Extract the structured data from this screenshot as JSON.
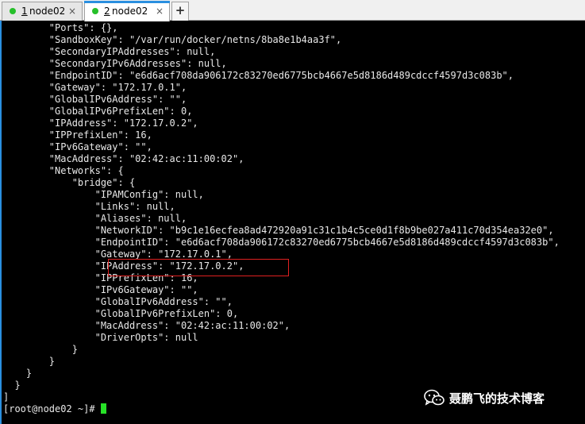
{
  "tabs": [
    {
      "number": "1",
      "name": "node02",
      "status_color": "#26c02a",
      "active": false
    },
    {
      "number": "2",
      "name": "node02",
      "status_color": "#26c02a",
      "active": true
    }
  ],
  "tab_close_glyph": "×",
  "add_tab_glyph": "+",
  "terminal": {
    "lines": [
      "        \"Ports\": {},",
      "        \"SandboxKey\": \"/var/run/docker/netns/8ba8e1b4aa3f\",",
      "        \"SecondaryIPAddresses\": null,",
      "        \"SecondaryIPv6Addresses\": null,",
      "        \"EndpointID\": \"e6d6acf708da906172c83270ed6775bcb4667e5d8186d489cdccf4597d3c083b\",",
      "        \"Gateway\": \"172.17.0.1\",",
      "        \"GlobalIPv6Address\": \"\",",
      "        \"GlobalIPv6PrefixLen\": 0,",
      "        \"IPAddress\": \"172.17.0.2\",",
      "        \"IPPrefixLen\": 16,",
      "        \"IPv6Gateway\": \"\",",
      "        \"MacAddress\": \"02:42:ac:11:00:02\",",
      "        \"Networks\": {",
      "            \"bridge\": {",
      "                \"IPAMConfig\": null,",
      "                \"Links\": null,",
      "                \"Aliases\": null,",
      "                \"NetworkID\": \"b9c1e16ecfea8ad472920a91c31c1b4c5ce0d1f8b9be027a411c70d354ea32e0\",",
      "                \"EndpointID\": \"e6d6acf708da906172c83270ed6775bcb4667e5d8186d489cdccf4597d3c083b\",",
      "                \"Gateway\": \"172.17.0.1\",",
      "                \"IPAddress\": \"172.17.0.2\",",
      "                \"IPPrefixLen\": 16,",
      "                \"IPv6Gateway\": \"\",",
      "                \"GlobalIPv6Address\": \"\",",
      "                \"GlobalIPv6PrefixLen\": 0,",
      "                \"MacAddress\": \"02:42:ac:11:00:02\",",
      "                \"DriverOpts\": null",
      "            }",
      "        }",
      "    }",
      "  }",
      "]"
    ],
    "prompt": "[root@node02 ~]# ",
    "cursor_color": "#27e227",
    "highlight_color": "#e02020"
  },
  "watermark": {
    "text": "聂鹏飞的技术博客",
    "icon": "wechat-icon"
  }
}
